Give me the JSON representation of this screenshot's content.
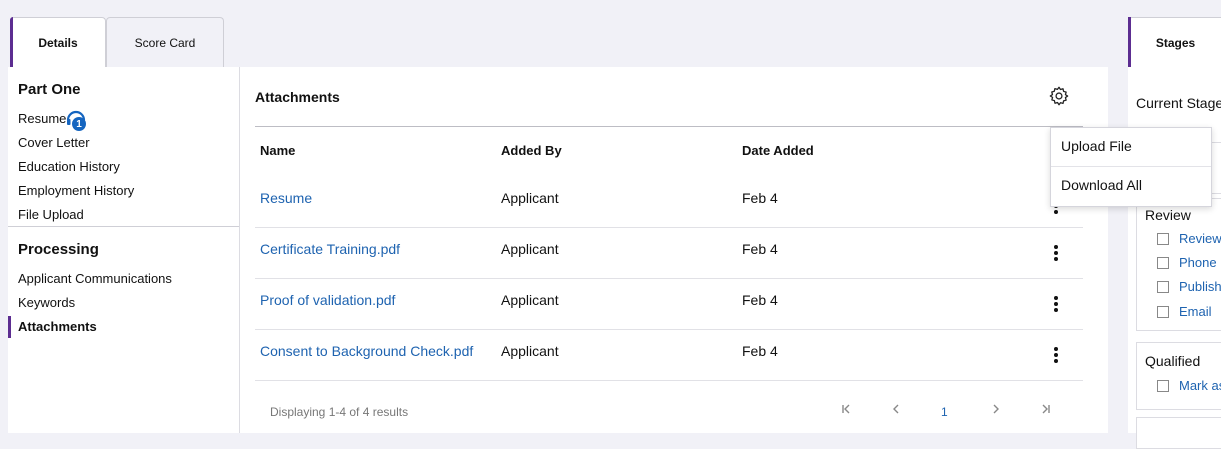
{
  "tabs": {
    "details": "Details",
    "score_card": "Score Card"
  },
  "left_nav": {
    "part_one": {
      "title": "Part One",
      "items": [
        "Resume",
        "Cover Letter",
        "Education History",
        "Employment History",
        "File Upload"
      ],
      "resume_badge": "1"
    },
    "processing": {
      "title": "Processing",
      "items": [
        "Applicant Communications",
        "Keywords",
        "Attachments"
      ]
    }
  },
  "attachments": {
    "title": "Attachments",
    "columns": {
      "name": "Name",
      "added_by": "Added By",
      "date_added": "Date Added"
    },
    "rows": [
      {
        "name": "Resume",
        "added_by": "Applicant",
        "date": "Feb 4"
      },
      {
        "name": "Certificate Training.pdf",
        "added_by": "Applicant",
        "date": "Feb 4"
      },
      {
        "name": "Proof of validation.pdf",
        "added_by": "Applicant",
        "date": "Feb 4"
      },
      {
        "name": "Consent to Background Check.pdf",
        "added_by": "Applicant",
        "date": "Feb 4"
      }
    ],
    "pagination": {
      "summary": "Displaying 1-4 of 4 results",
      "current_page": "1"
    }
  },
  "settings_menu": {
    "upload": "Upload File",
    "download": "Download All"
  },
  "stages": {
    "tab": "Stages",
    "current_stage": "Current Stage",
    "review": {
      "title": "Review",
      "items": [
        "Review",
        "Phone",
        "Publish",
        "Email"
      ]
    },
    "qualified": {
      "title": "Qualified",
      "items": [
        "Mark as"
      ]
    }
  },
  "colors": {
    "accent": "#5c2d91",
    "link": "#1e63b0",
    "badge": "#1565c0"
  }
}
